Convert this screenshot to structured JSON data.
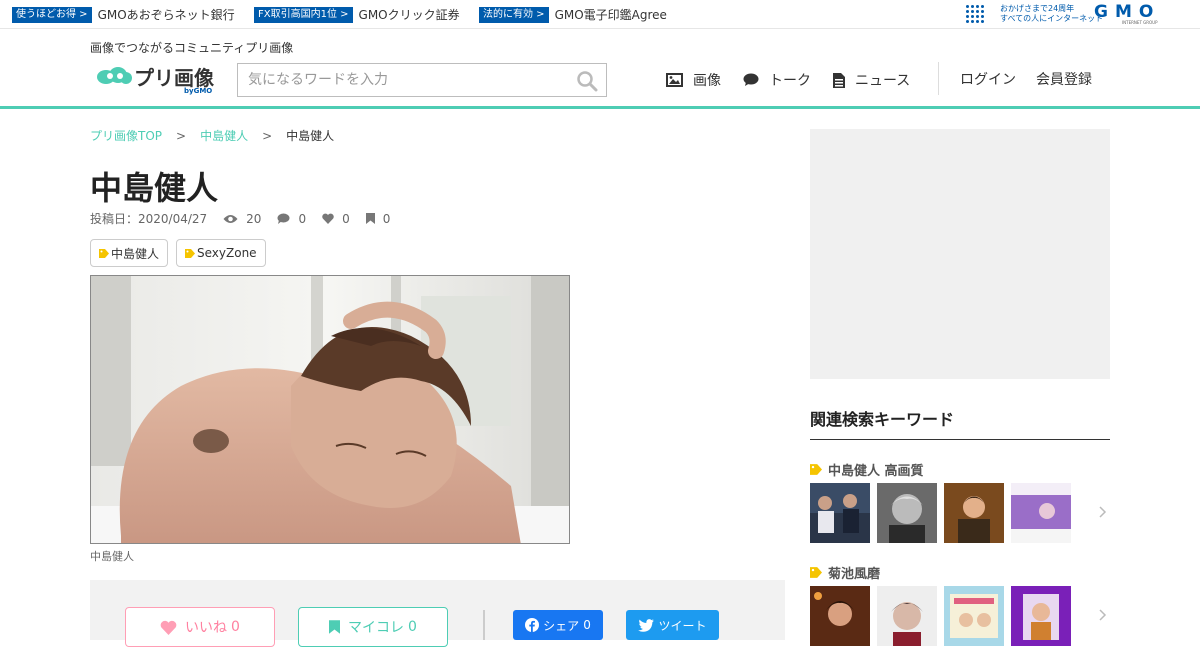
{
  "gmo_bar": {
    "items": [
      {
        "badge": "使うほどお得 >",
        "text": "GMOあおぞらネット銀行"
      },
      {
        "badge": "FX取引高国内1位 >",
        "text": "GMOクリック証券"
      },
      {
        "badge": "法的に有効 >",
        "text": "GMO電子印鑑Agree"
      }
    ],
    "anniversary_line1": "おかげさまで24周年",
    "anniversary_line2": "すべての人にインターネット",
    "logo": "GMO",
    "logo_sub": "INTERNET GROUP",
    "brand_color": "#005bac"
  },
  "header": {
    "tagline": "画像でつながるコミュニティプリ画像",
    "logo_text": "プリ画像",
    "logo_by": "byGMO",
    "search_placeholder": "気になるワードを入力",
    "nav": [
      {
        "icon": "image-icon",
        "label": "画像"
      },
      {
        "icon": "comment-icon",
        "label": "トーク"
      },
      {
        "icon": "document-icon",
        "label": "ニュース"
      }
    ],
    "login": "ログイン",
    "register": "会員登録",
    "accent_color": "#4ecdb4"
  },
  "breadcrumb": {
    "items": [
      "プリ画像TOP",
      "中島健人"
    ],
    "current": "中島健人",
    "separator": ">"
  },
  "post": {
    "title": "中島健人",
    "date": "投稿日：2020/04/27",
    "views": "20",
    "comments": "0",
    "likes": "0",
    "bookmarks": "0",
    "tags": [
      "中島健人",
      "SexyZone"
    ],
    "caption": "中島健人"
  },
  "actions": {
    "like_label": "いいね",
    "like_count": "0",
    "mycolle_label": "マイコレ",
    "mycolle_count": "0",
    "share_label": "シェア",
    "share_count": "0",
    "tweet_label": "ツイート"
  },
  "sidebar": {
    "title": "関連検索キーワード",
    "keywords": [
      {
        "label": "中島健人 高画質"
      },
      {
        "label": "菊池風磨"
      }
    ]
  }
}
